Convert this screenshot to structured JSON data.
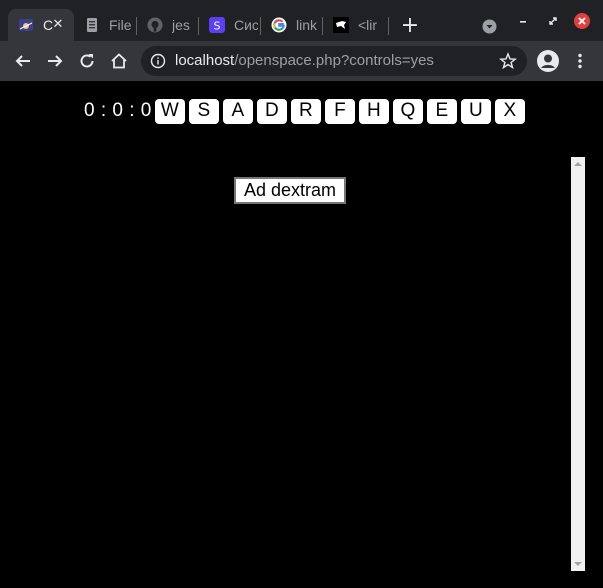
{
  "browser": {
    "tabs": [
      {
        "title": "C",
        "icon": "space-icon",
        "active": true
      },
      {
        "title": "File",
        "icon": "file-icon"
      },
      {
        "title": "jes",
        "icon": "github-icon"
      },
      {
        "title": "Сис",
        "icon": "s-badge-icon"
      },
      {
        "title": "link",
        "icon": "google-icon"
      },
      {
        "title": "<lir",
        "icon": "bird-icon"
      }
    ],
    "new_tab_label": "+",
    "url_host": "localhost",
    "url_path": "/openspace.php?controls=yes",
    "colors": {
      "frame": "#202124",
      "toolbar": "#35363a",
      "close_button": "#e0413f"
    }
  },
  "page": {
    "timer": "0 : 0 : 0",
    "controls": [
      "W",
      "S",
      "A",
      "D",
      "R",
      "F",
      "H",
      "Q",
      "E",
      "U",
      "X"
    ],
    "action_button": "Ad dextram",
    "colors": {
      "background": "#000000",
      "button": "#ffffff"
    }
  }
}
